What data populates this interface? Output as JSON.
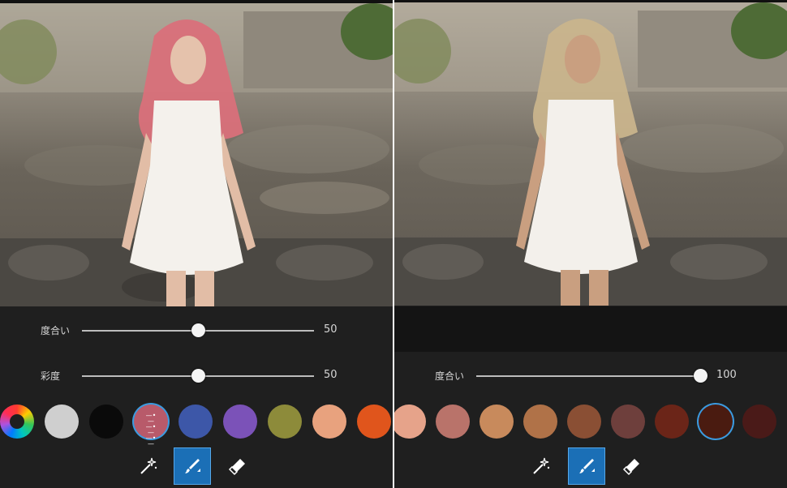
{
  "left_panel": {
    "sliders": [
      {
        "label": "度合い",
        "value": "50",
        "fraction": 0.5
      },
      {
        "label": "彩度",
        "value": "50",
        "fraction": 0.5
      }
    ],
    "swatches": [
      {
        "name": "color-wheel",
        "color": "conic"
      },
      {
        "name": "silver-hair",
        "color": "#cfcfcf"
      },
      {
        "name": "black-hair",
        "color": "#0a0a0a"
      },
      {
        "name": "rose-hair-adjust",
        "color": "#b85a6a",
        "selected": true
      },
      {
        "name": "blue-hair",
        "color": "#3d57a8"
      },
      {
        "name": "purple-hair",
        "color": "#7b52b8"
      },
      {
        "name": "olive-hair",
        "color": "#8d8b3a"
      },
      {
        "name": "peach-hair",
        "color": "#e8a27e"
      },
      {
        "name": "orange-hair",
        "color": "#e0551c"
      }
    ],
    "hair_color": "#d9707a"
  },
  "right_panel": {
    "sliders": [
      {
        "label": "度合い",
        "value": "100",
        "fraction": 1.0
      }
    ],
    "swatches": [
      {
        "name": "skin-1",
        "color": "#e6a38a"
      },
      {
        "name": "skin-2",
        "color": "#b9736a"
      },
      {
        "name": "skin-3",
        "color": "#c88a5c"
      },
      {
        "name": "skin-4",
        "color": "#b07248"
      },
      {
        "name": "skin-5",
        "color": "#8a4f34"
      },
      {
        "name": "skin-6",
        "color": "#6e3f3c"
      },
      {
        "name": "skin-7",
        "color": "#6b2518"
      },
      {
        "name": "skin-8",
        "color": "#4a1b10",
        "selected": true
      },
      {
        "name": "skin-9",
        "color": "#4a1a18"
      }
    ],
    "hair_color": "#c9b48c"
  },
  "toolbar": {
    "tools": [
      {
        "name": "magic-wand-icon",
        "active": false
      },
      {
        "name": "brush-icon",
        "active": true
      },
      {
        "name": "eraser-icon",
        "active": false
      }
    ]
  }
}
